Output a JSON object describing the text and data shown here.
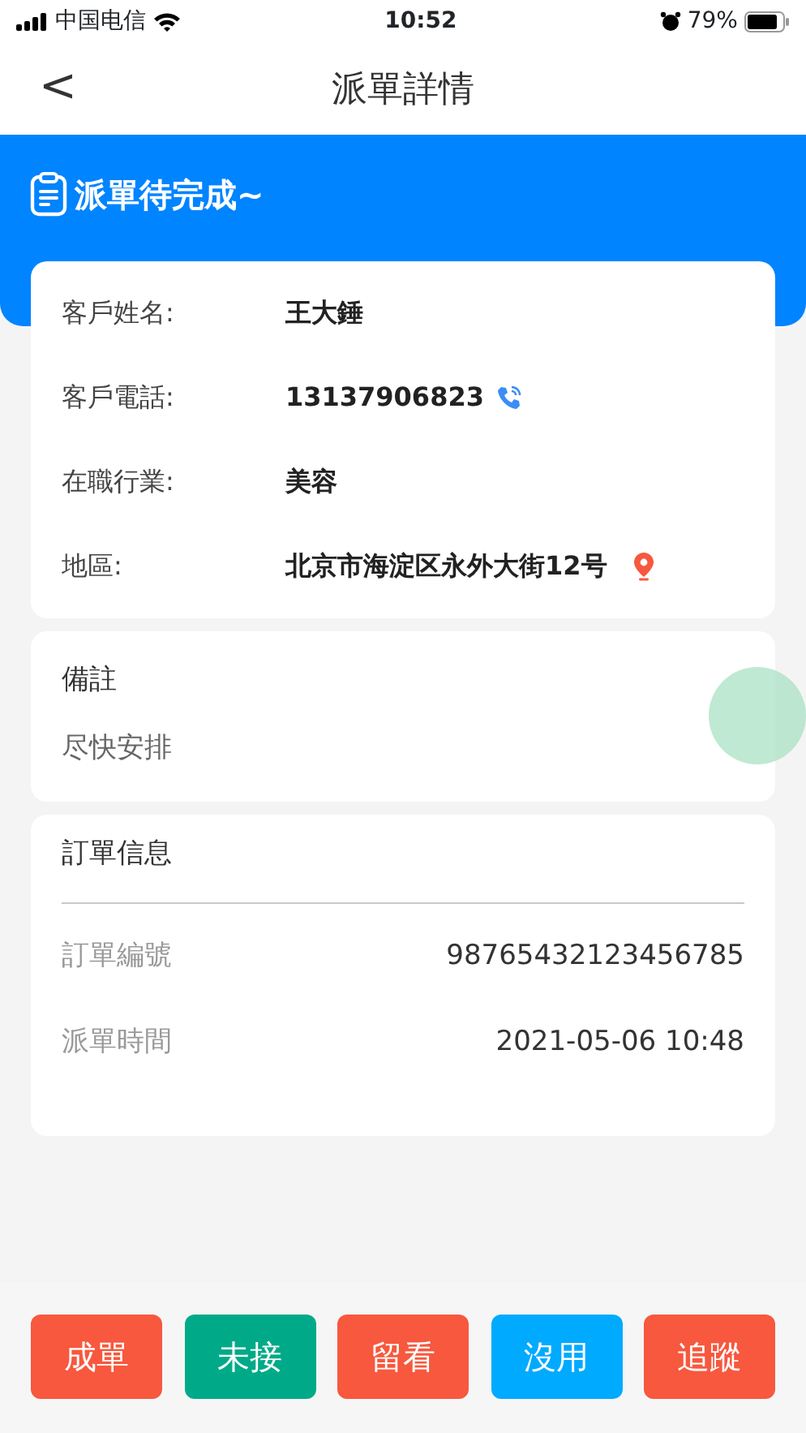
{
  "status_bar": {
    "carrier": "中国电信",
    "time": "10:52",
    "battery": "79%"
  },
  "nav": {
    "back": "<",
    "title": "派單詳情"
  },
  "banner": {
    "title": "派單待完成~"
  },
  "customer": [
    {
      "label": "客戶姓名:",
      "value": "王大錘",
      "kind": "text"
    },
    {
      "label": "客戶電話:",
      "value": "13137906823",
      "kind": "phone"
    },
    {
      "label": "在職行業:",
      "value": "美容",
      "kind": "text"
    },
    {
      "label": "地區:",
      "value": "北京市海淀区永外大街12号",
      "kind": "location"
    }
  ],
  "notes": {
    "title": "備註",
    "text": "尽快安排"
  },
  "order": {
    "title": "訂單信息",
    "rows": [
      {
        "label": "訂單編號",
        "value": "98765432123456785"
      },
      {
        "label": "派單時間",
        "value": "2021-05-06 10:48"
      }
    ]
  },
  "actions": [
    {
      "label": "成單",
      "color": "#f7583e"
    },
    {
      "label": "未接",
      "color": "#00aa88"
    },
    {
      "label": "留看",
      "color": "#f7583e"
    },
    {
      "label": "沒用",
      "color": "#00aaff"
    },
    {
      "label": "追蹤",
      "color": "#f7583e"
    }
  ]
}
